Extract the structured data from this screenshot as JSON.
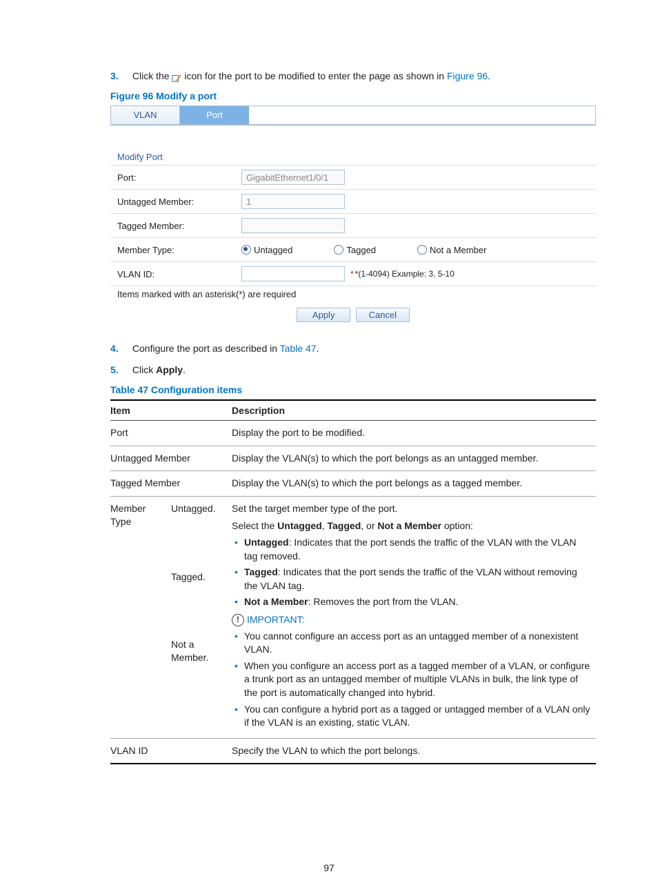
{
  "step3": {
    "num": "3.",
    "pre": "Click the ",
    "post": " icon for the port to be modified to enter the page as shown in ",
    "link": "Figure 96",
    "tail": "."
  },
  "fig_caption": "Figure 96 Modify a port",
  "tabs": {
    "vlan": "VLAN",
    "port": "Port"
  },
  "form": {
    "title": "Modify Port",
    "port_label": "Port:",
    "port_value": "GigabitEthernet1/0/1",
    "untag_label": "Untagged Member:",
    "untag_value": "1",
    "tag_label": "Tagged Member:",
    "tag_value": "",
    "mtype_label": "Member Type:",
    "mtype_untagged": "Untagged",
    "mtype_tagged": "Tagged",
    "mtype_not": "Not a Member",
    "vlan_id_label": "VLAN ID:",
    "vlan_id_value": "",
    "vlan_id_hint": "*(1-4094) Example: 3, 5-10",
    "req_note": "Items marked with an asterisk(*) are required",
    "apply": "Apply",
    "cancel": "Cancel"
  },
  "step4": {
    "num": "4.",
    "pre": "Configure the port as described in ",
    "link": "Table 47",
    "tail": "."
  },
  "step5": {
    "num": "5.",
    "pre": "Click ",
    "bold": "Apply",
    "tail": "."
  },
  "table_caption": "Table 47 Configuration items",
  "thead": {
    "item": "Item",
    "desc": "Description"
  },
  "rows": {
    "port": {
      "item": "Port",
      "desc": "Display the port to be modified."
    },
    "um": {
      "item": "Untagged Member",
      "desc": "Display the VLAN(s) to which the port belongs as an untagged member."
    },
    "tm": {
      "item": "Tagged Member",
      "desc": "Display the VLAN(s) to which the port belongs as a tagged member."
    },
    "mt": {
      "item": "Member Type",
      "sub1": "Untagged.",
      "sub2": "Tagged.",
      "sub3": "Not a Member.",
      "line1": "Set the target member type of the port.",
      "line2a": "Select the ",
      "line2b": "Untagged",
      "line2c": ", ",
      "line2d": "Tagged",
      "line2e": ", or ",
      "line2f": "Not a Member",
      "line2g": " option:",
      "b1a": "Untagged",
      "b1b": ": Indicates that the port sends the traffic of the VLAN with the VLAN tag removed.",
      "b2a": "Tagged",
      "b2b": ": Indicates that the port sends the traffic of the VLAN without removing the VLAN tag.",
      "b3a": "Not a Member",
      "b3b": ": Removes the port from the VLAN.",
      "important": "IMPORTANT:",
      "i1": "You cannot configure an access port as an untagged member of a nonexistent VLAN.",
      "i2": "When you configure an access port as a tagged member of a VLAN, or configure a trunk port as an untagged member of multiple VLANs in bulk, the link type of the port is automatically changed into hybrid.",
      "i3": "You can configure a hybrid port as a tagged or untagged member of a VLAN only if the VLAN is an existing, static VLAN."
    },
    "vid": {
      "item": "VLAN ID",
      "desc": "Specify the VLAN to which the port belongs."
    }
  },
  "page_number": "97"
}
